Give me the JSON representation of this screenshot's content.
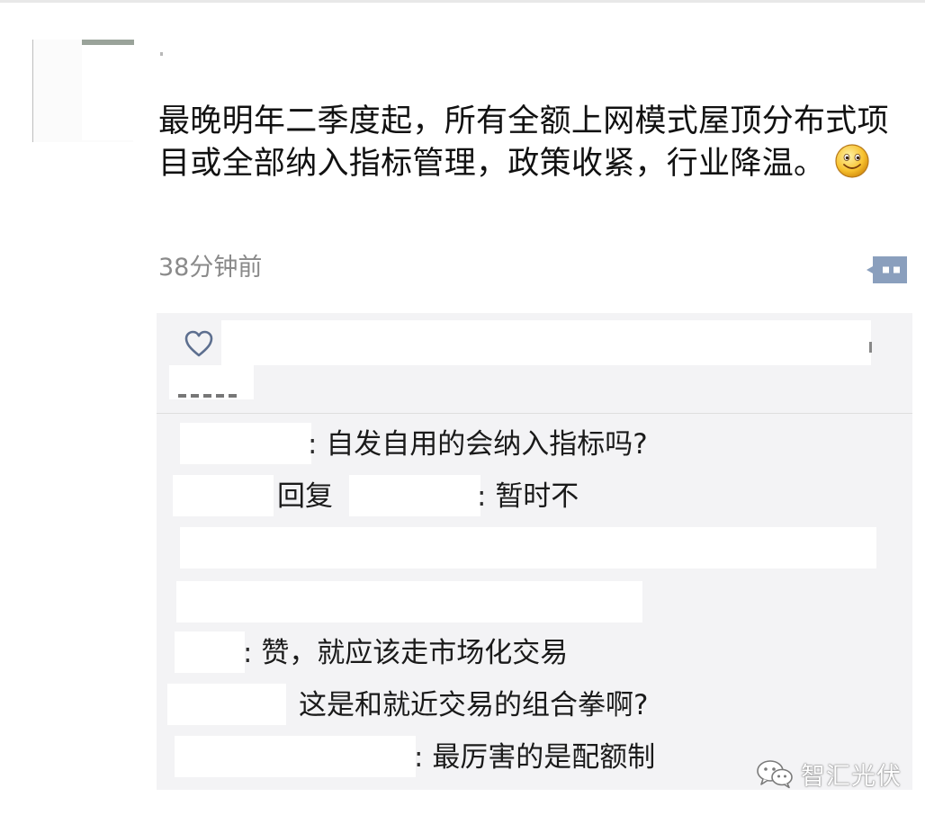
{
  "post": {
    "text": "最晚明年二季度起，所有全额上网模式屋顶分布式项目或全部纳入指标管理，政策收紧，行业降温。",
    "emoji": "smiley-emoji",
    "timestamp": "38分钟前"
  },
  "likes": {
    "icon": "heart-icon"
  },
  "comments": [
    {
      "prefix": "",
      "reply_word": "",
      "sep": ": ",
      "body": "自发自用的会纳入指标吗?"
    },
    {
      "prefix": "",
      "reply_word": "回复",
      "sep": ": ",
      "body": "暂时不"
    },
    {
      "prefix": "",
      "reply_word": "",
      "sep": "",
      "body": ""
    },
    {
      "prefix": "",
      "reply_word": "",
      "sep": "",
      "body": ""
    },
    {
      "prefix": "",
      "reply_word": "",
      "sep": ": ",
      "body": "赞，就应该走市场化交易"
    },
    {
      "prefix": "",
      "reply_word": "",
      "sep": "",
      "body": "这是和就近交易的组合拳啊?"
    },
    {
      "prefix": "",
      "reply_word": "",
      "sep": ": ",
      "body": "最厉害的是配额制"
    }
  ],
  "watermark": {
    "text": "智汇光伏",
    "icon": "wechat-icon"
  },
  "colors": {
    "panel": "#f3f3f5",
    "timestamp": "#8a8a8a",
    "more_button": "#8a9fbd"
  }
}
